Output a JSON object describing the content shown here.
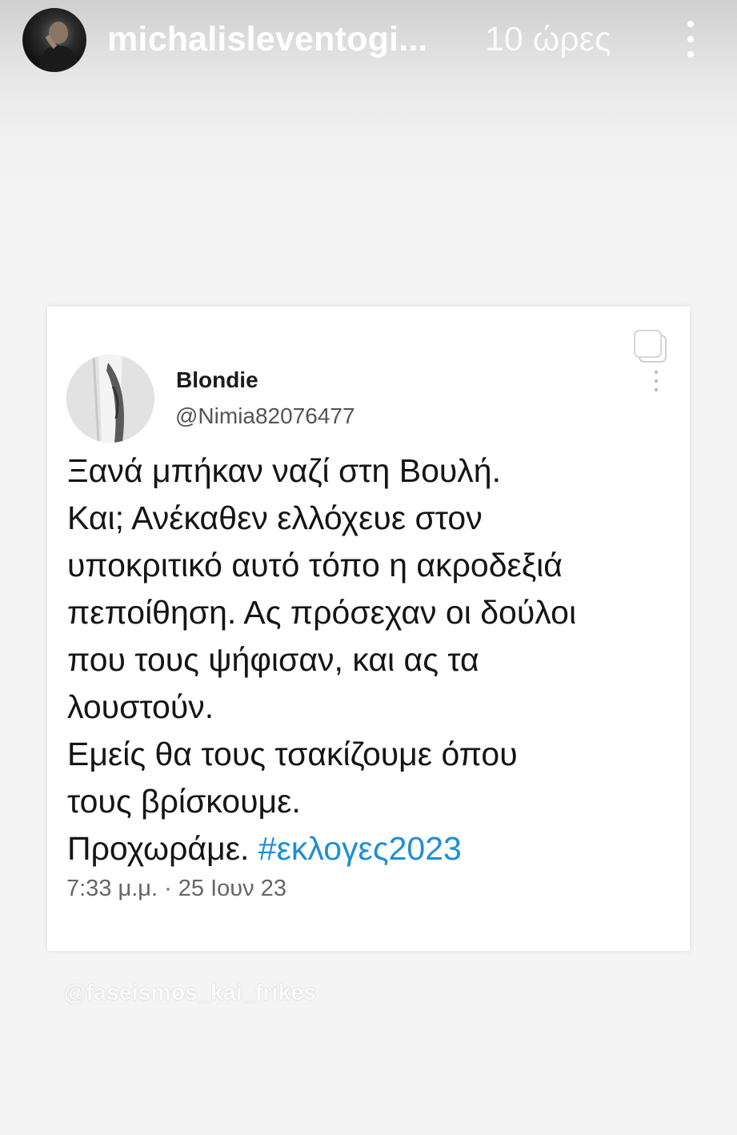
{
  "story": {
    "username": "michalisleventogi...",
    "time_ago": "10 ώρες",
    "avatar_icon": "person-avatar-icon",
    "more_icon": "vertical-dots-icon"
  },
  "tweet": {
    "display_name": "Blondie",
    "handle": "@Nimia82076477",
    "lines": [
      "Ξανά μπήκαν ναζί στη Βουλή.",
      "Και; Ανέκαθεν ελλόχευε στον",
      "υποκριτικό αυτό τόπο η ακροδεξιά",
      "πεποίθηση. Ας πρόσεχαν οι δούλοι",
      "που τους ψήφισαν, και ας τα",
      "λουστούν.",
      "Εμείς θα τους τσακίζουμε όπου",
      "τους βρίσκουμε."
    ],
    "last_line_text": "Προχωράμε.",
    "hashtag": "#εκλογες2023",
    "timestamp": "7:33 μ.μ. · 25 Ιουν 23",
    "hashtag_color": "#1d8fd6"
  },
  "watermark": "@faseismos_kai_frikes"
}
